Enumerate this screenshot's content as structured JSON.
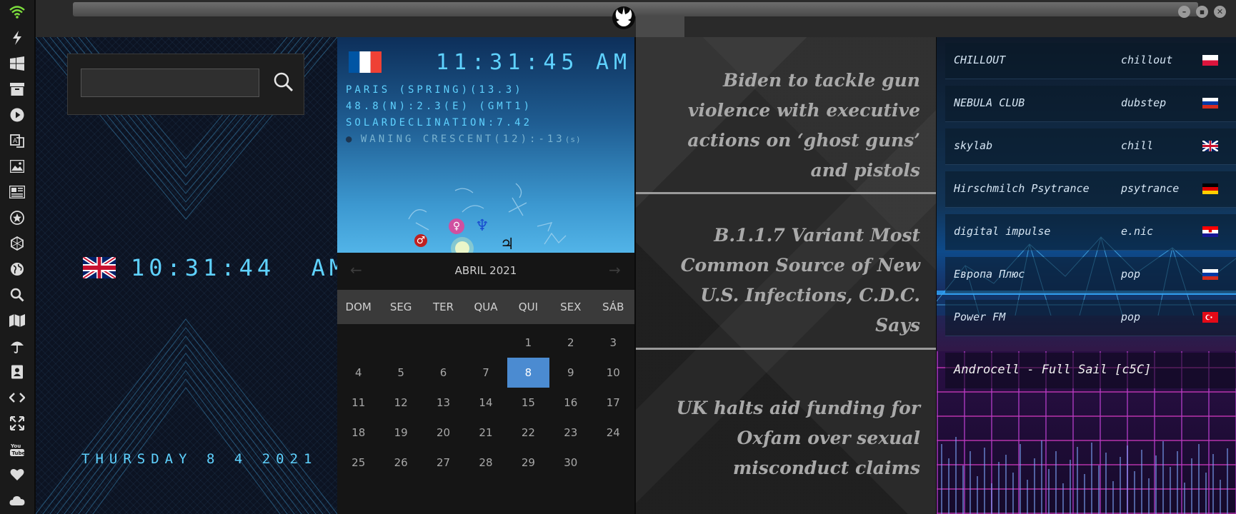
{
  "sidebar": {
    "icons": [
      "wifi-icon",
      "lightning-icon",
      "windows-icon",
      "archive-icon",
      "play-icon",
      "translate-icon",
      "image-icon",
      "news-icon",
      "star-badge-icon",
      "hexagon-icon",
      "globe-icon",
      "search-icon",
      "map-icon",
      "umbrella-icon",
      "contacts-icon",
      "code-icon",
      "expand-icon",
      "youtube-icon",
      "heart-icon",
      "cloud-icon"
    ],
    "accent": "#7cdc3c"
  },
  "window": {
    "logo": "rebel-alliance-logo",
    "controls": [
      "minimize-button",
      "maximize-button",
      "close-button"
    ]
  },
  "search": {
    "value": "",
    "placeholder": ""
  },
  "uk_clock": {
    "time": "10:31:44",
    "ampm": "AM",
    "date": "THURSDAY 8 4 2021"
  },
  "paris": {
    "time": "11:31:45",
    "ampm": "AM",
    "line1": "PARIS (SPRING)(13.3)",
    "line2": "48.8(N):2.3(E) (GMT1)",
    "line3": "SOLARDECLINATION:7.42",
    "line4": "WANING CRESCENT(12):-13",
    "line4_suffix": "(s)",
    "planets": [
      "♂",
      "♀",
      "♆",
      "♃"
    ]
  },
  "calendar": {
    "month": "ABRIL 2021",
    "prev": "←",
    "next": "→",
    "weekdays": [
      "DOM",
      "SEG",
      "TER",
      "QUA",
      "QUI",
      "SEX",
      "SÁB"
    ],
    "weeks": [
      [
        "",
        "",
        "",
        "1",
        "2",
        "3"
      ],
      [
        "4",
        "5",
        "6",
        "7",
        "8",
        "9",
        "10"
      ],
      [
        "11",
        "12",
        "13",
        "14",
        "15",
        "16",
        "17"
      ],
      [
        "18",
        "19",
        "20",
        "21",
        "22",
        "23",
        "24"
      ],
      [
        "25",
        "26",
        "27",
        "28",
        "29",
        "30",
        ""
      ]
    ],
    "selected": "8",
    "accent": "#4b8bd1"
  },
  "news": {
    "headlines": [
      "Biden to tackle gun violence with executive actions on ‘ghost guns’ and pistols",
      "B.1.1.7 Variant Most Common Source of New U.S. Infections, C.D.C. Says",
      "UK halts aid funding for Oxfam over sexual misconduct claims"
    ]
  },
  "radio": {
    "stations": [
      {
        "name": "CHILLOUT",
        "genre": "chillout",
        "flag": "poland"
      },
      {
        "name": "NEBULA CLUB",
        "genre": "dubstep",
        "flag": "russia"
      },
      {
        "name": "skylab",
        "genre": "chill",
        "flag": "uk"
      },
      {
        "name": "Hirschmilch Psytrance",
        "genre": "psytrance",
        "flag": "germany"
      },
      {
        "name": "digital impulse",
        "genre": "e.nic",
        "flag": "croatia"
      },
      {
        "name": "Европа Плюс",
        "genre": "pop",
        "flag": "russia"
      },
      {
        "name": "Power FM",
        "genre": "pop",
        "flag": "turkey"
      }
    ],
    "now_playing": "Androcell - Full Sail [c5C]"
  }
}
